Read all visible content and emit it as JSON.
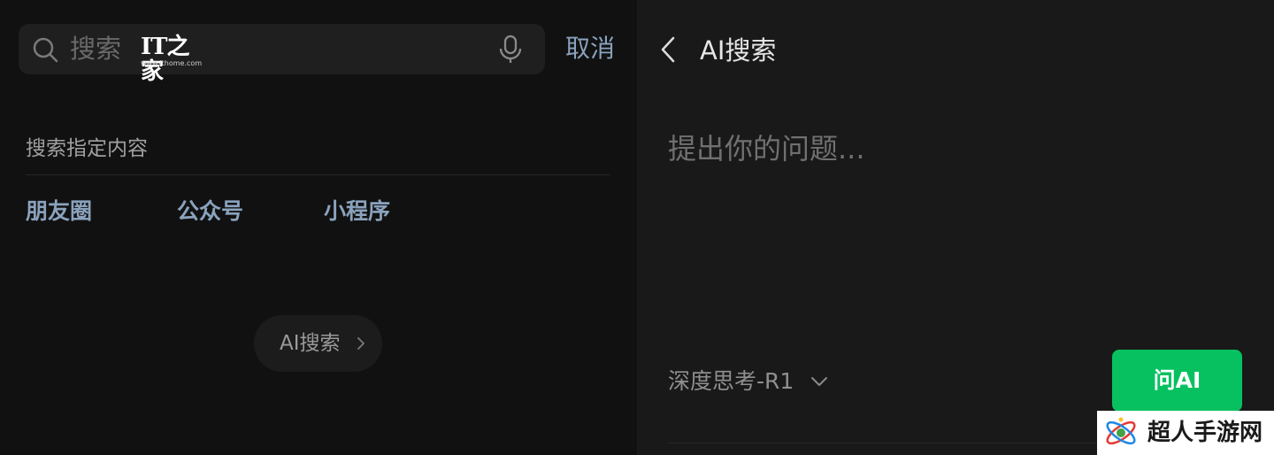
{
  "left_panel": {
    "search": {
      "placeholder": "搜索",
      "icon": "search-icon",
      "mic_icon": "mic-icon"
    },
    "logo": {
      "mark": "IT之家",
      "url": "www.ithome.com"
    },
    "cancel_label": "取消",
    "section_title": "搜索指定内容",
    "categories": [
      {
        "label": "朋友圈"
      },
      {
        "label": "公众号"
      },
      {
        "label": "小程序"
      }
    ],
    "ai_search_button": {
      "label": "AI搜索",
      "icon": "chevron-right-icon"
    }
  },
  "right_panel": {
    "back_icon": "chevron-left-icon",
    "title": "AI搜索",
    "question_placeholder": "提出你的问题...",
    "model": {
      "label": "深度思考-R1",
      "icon": "chevron-down-icon"
    },
    "ask_button": {
      "label": "问AI",
      "color": "#07c160"
    }
  },
  "watermark": {
    "text": "超人手游网"
  },
  "colors": {
    "link_blue": "#8aa2bd",
    "accent_green": "#07c160",
    "left_background": "#111111",
    "right_background": "#191919"
  }
}
